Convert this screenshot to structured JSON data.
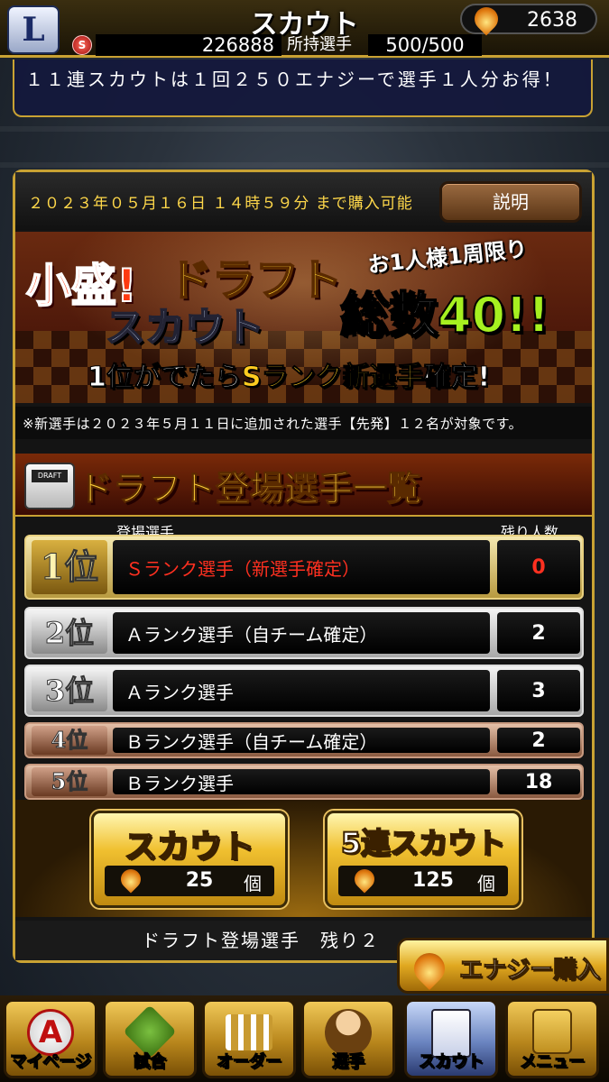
{
  "header": {
    "logo": "L",
    "title": "スカウト",
    "energy": "2638",
    "coin_icon": "S",
    "coins": "226888",
    "owned_label": "所持選手",
    "owned_value": "500/500"
  },
  "notice": "１１連スカウトは１回２５０エナジーで選手１人分お得！",
  "period": {
    "text": "２０２３年０５月１６日 １４時５９分 まで購入可能",
    "explain_button": "説明"
  },
  "banner": {
    "komori": "小盛!",
    "draft": "ドラフト",
    "scout": "スカウト",
    "limit": "お1人様1周限り",
    "total_prefix": "総数",
    "total_value": "40!!",
    "sub_prefix": "1位がでたら",
    "sub_highlight": "Sランク新選手",
    "sub_suffix": "確定!"
  },
  "rule_note": "※新選手は２０２３年５月１１日に追加された選手【先発】１２名が対象です。",
  "list": {
    "box_label": "DRAFT",
    "title": "ドラフト登場選手一覧",
    "col_name": "登場選手",
    "col_remaining": "残り人数",
    "rows": [
      {
        "rank": "1位",
        "name": "Ｓランク選手（新選手確定）",
        "remaining": "0"
      },
      {
        "rank": "2位",
        "name": "Ａランク選手（自チーム確定）",
        "remaining": "2"
      },
      {
        "rank": "3位",
        "name": "Ａランク選手",
        "remaining": "3"
      },
      {
        "rank": "4位",
        "name": "Ｂランク選手（自チーム確定）",
        "remaining": "2"
      },
      {
        "rank": "5位",
        "name": "Ｂランク選手",
        "remaining": "18"
      }
    ]
  },
  "scout_buttons": [
    {
      "label": "スカウト",
      "cost": "25",
      "unit": "個"
    },
    {
      "label": "5連スカウト",
      "cost": "125",
      "unit": "個"
    }
  ],
  "remaining_text": "ドラフト登場選手　残り２",
  "energy_purchase": "エナジー購入",
  "nav": [
    "マイページ",
    "試合",
    "オーダー",
    "選手",
    "スカウト",
    "メニュー"
  ],
  "colors": {
    "accent_gold": "#c9a233",
    "highlight_red": "#ff3020",
    "notice_bg": "#141c3c"
  }
}
